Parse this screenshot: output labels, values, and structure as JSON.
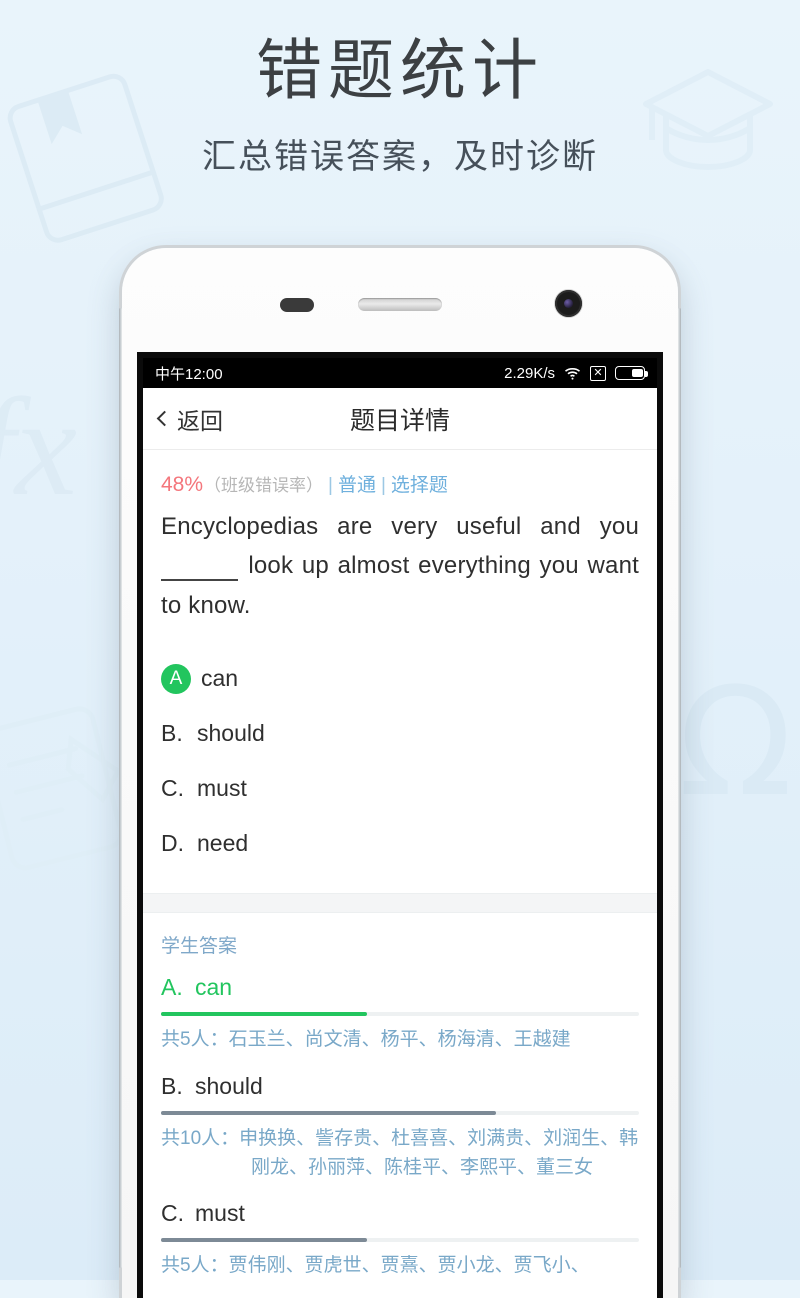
{
  "promo": {
    "title": "错题统计",
    "subtitle": "汇总错误答案，及时诊断",
    "background_color": "#e6f2fa",
    "watermarks": [
      "book-icon",
      "graduation-cap-icon",
      "fx-icon",
      "document-pencil-icon",
      "omega-icon"
    ]
  },
  "statusbar": {
    "time": "中午12:00",
    "network_speed": "2.29K/s",
    "wifi": "wifi-icon",
    "signal": "x-signal-icon",
    "battery": "battery-icon"
  },
  "navbar": {
    "back_label": "返回",
    "title": "题目详情"
  },
  "meta": {
    "error_rate": "48%",
    "error_rate_label": "（班级错误率）",
    "separator": "|",
    "difficulty": "普通",
    "question_type": "选择题",
    "error_rate_color": "#f4767c",
    "tag_color": "#6fb0dd"
  },
  "question": {
    "part1": "Encyclopedias are very useful and you",
    "blank": "",
    "part2": "look up almost everything you want to know."
  },
  "options": [
    {
      "letter": "A",
      "label": "A",
      "text": "can",
      "correct": true,
      "badge_color": "#22c55e"
    },
    {
      "letter": "B",
      "label": "B.",
      "text": "should",
      "correct": false
    },
    {
      "letter": "C",
      "label": "C.",
      "text": "must",
      "correct": false
    },
    {
      "letter": "D",
      "label": "D.",
      "text": "need",
      "correct": false
    }
  ],
  "answers": {
    "header": "学生答案",
    "items": [
      {
        "letter": "A.",
        "text": "can",
        "correct": true,
        "bar_percent": 43,
        "bar_color": "#22c55e",
        "count_label": "共5人：",
        "names": "石玉兰、尚文清、杨平、杨海清、王越建"
      },
      {
        "letter": "B.",
        "text": "should",
        "correct": false,
        "bar_percent": 70,
        "bar_color": "#7d8a96",
        "count_label": "共10人：",
        "names": "申换换、訾存贵、杜喜喜、刘满贵、刘润生、韩刚龙、孙丽萍、陈桂平、李熙平、董三女"
      },
      {
        "letter": "C.",
        "text": "must",
        "correct": false,
        "bar_percent": 43,
        "bar_color": "#7d8a96",
        "count_label": "共5人：",
        "names": "贾伟刚、贾虎世、贾熹、贾小龙、贾飞小、"
      }
    ]
  }
}
